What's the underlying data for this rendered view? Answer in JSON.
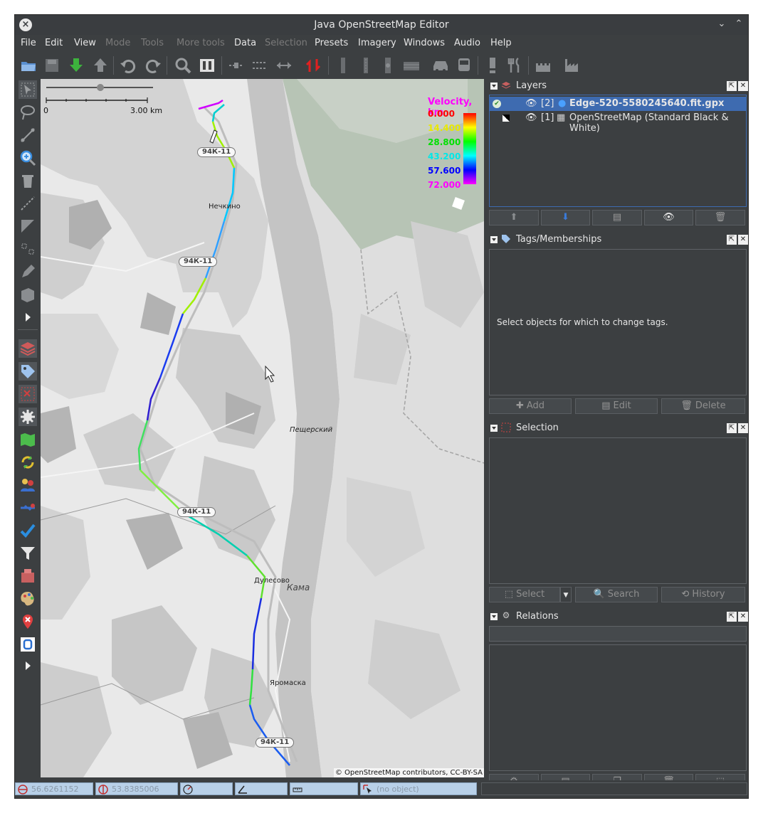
{
  "window": {
    "title": "Java OpenStreetMap Editor",
    "close_glyph": "×",
    "minimize_glyph": "⌄",
    "maximize_glyph": "⌃"
  },
  "menu": {
    "items": [
      {
        "label": "File",
        "enabled": true
      },
      {
        "label": "Edit",
        "enabled": true
      },
      {
        "label": "View",
        "enabled": true
      },
      {
        "label": "Mode",
        "enabled": false
      },
      {
        "label": "Tools",
        "enabled": false
      },
      {
        "label": "More tools",
        "enabled": false
      },
      {
        "label": "Data",
        "enabled": true
      },
      {
        "label": "Selection",
        "enabled": false
      },
      {
        "label": "Presets",
        "enabled": true
      },
      {
        "label": "Imagery",
        "enabled": true
      },
      {
        "label": "Windows",
        "enabled": true
      },
      {
        "label": "Audio",
        "enabled": true
      },
      {
        "label": "Help",
        "enabled": true
      }
    ]
  },
  "map": {
    "scale": {
      "start": "0",
      "end": "3.00 km"
    },
    "legend": {
      "title": "Velocity, km",
      "values": [
        {
          "label": "0.000",
          "color": "#ff0000"
        },
        {
          "label": "14.400",
          "color": "#ffff00"
        },
        {
          "label": "28.800",
          "color": "#00ff00"
        },
        {
          "label": "43.200",
          "color": "#00ffff"
        },
        {
          "label": "57.600",
          "color": "#0000ff"
        },
        {
          "label": "72.000",
          "color": "#ff00ff"
        }
      ]
    },
    "places": [
      {
        "name": "Нечкино",
        "key": "nechkino"
      },
      {
        "name": "Пещерский",
        "key": "peshchersky"
      },
      {
        "name": "Дулесово",
        "key": "dulesovo"
      },
      {
        "name": "Кама",
        "key": "kama"
      },
      {
        "name": "Яромаска",
        "key": "yaromaska"
      }
    ],
    "road_shields": [
      "94К-11",
      "94К-11",
      "94К-11",
      "94К-11"
    ],
    "attribution": "© OpenStreetMap contributors, CC-BY-SA"
  },
  "layers": {
    "title": "Layers",
    "rows": [
      {
        "index": "[2]",
        "name": "Edge-520-5580245640.fit.gpx",
        "selected": true
      },
      {
        "index": "[1]",
        "name": "OpenStreetMap (Standard Black & White)",
        "selected": false
      }
    ]
  },
  "tags": {
    "title": "Tags/Memberships",
    "empty_text": "Select objects for which to change tags.",
    "buttons": {
      "add": "Add",
      "edit": "Edit",
      "delete": "Delete"
    }
  },
  "selection": {
    "title": "Selection",
    "buttons": {
      "select": "Select",
      "search": "Search",
      "history": "History"
    }
  },
  "relations": {
    "title": "Relations"
  },
  "status": {
    "lat": "56.6261152",
    "lon": "53.8385006",
    "no_object": "(no object)"
  },
  "colors": {
    "window_bg": "#3c3f41",
    "selection_blue": "#3e6bb0",
    "map_bg": "#e9e9e9",
    "river": "#c8c8c8",
    "forest": "#a7b8a5"
  }
}
